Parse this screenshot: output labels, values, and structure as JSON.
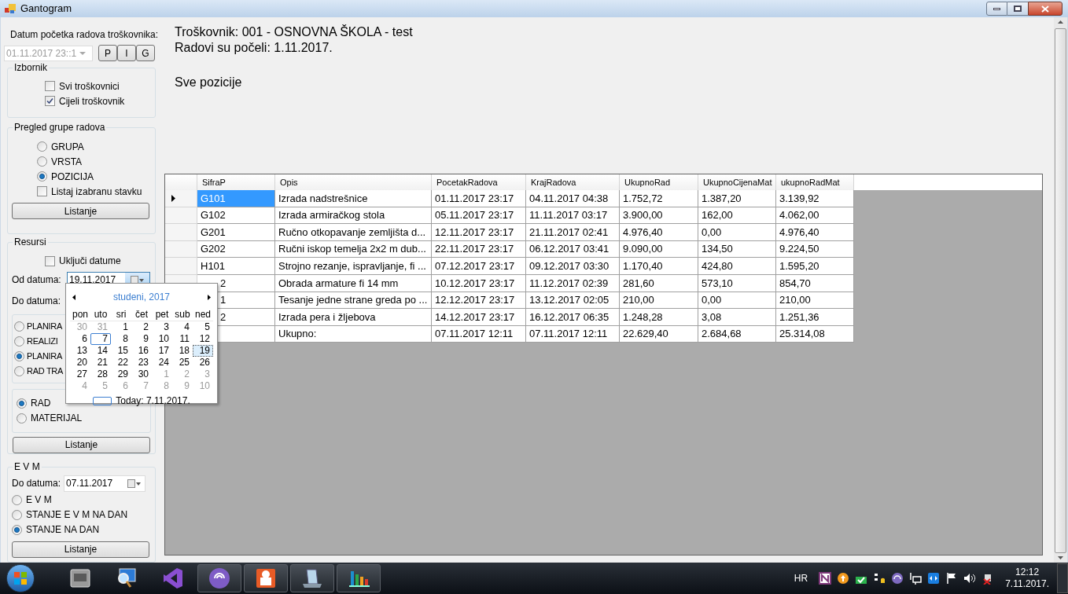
{
  "window": {
    "title": "Gantogram"
  },
  "left": {
    "start_label": "Datum početka radova troškovnika:",
    "start_value": "01.11.2017 23::1",
    "start_buttons": [
      "P",
      "I",
      "G"
    ],
    "izbornik": {
      "title": "Izbornik",
      "checkboxes": [
        {
          "label": "Svi troškovnici",
          "checked": false
        },
        {
          "label": "Cijeli troškovnik",
          "checked": true
        }
      ]
    },
    "pregled": {
      "title": "Pregled grupe radova",
      "radios": [
        {
          "label": "GRUPA",
          "selected": false
        },
        {
          "label": "VRSTA",
          "selected": false
        },
        {
          "label": "POZICIJA",
          "selected": true
        }
      ],
      "checkbox": {
        "label": "Listaj izabranu stavku",
        "checked": false
      },
      "button": "Listanje"
    },
    "resursi": {
      "title": "Resursi",
      "checkbox": {
        "label": "Uključi datume",
        "checked": false
      },
      "od_label": "Od datuma:",
      "od_value": "19.11.2017",
      "do_label": "Do datuma:",
      "radios": [
        {
          "label": "PLANIRA",
          "selected": false
        },
        {
          "label": "REALIZI",
          "selected": false
        },
        {
          "label": "PLANIRA",
          "selected": true
        },
        {
          "label": "RAD TRA",
          "selected": false
        }
      ],
      "radios2": [
        {
          "label": "RAD",
          "selected": true
        },
        {
          "label": "MATERIJAL",
          "selected": false
        }
      ],
      "button": "Listanje"
    },
    "evm": {
      "title": "E V M",
      "do_label": "Do datuma:",
      "do_value": "07.11.2017",
      "radios": [
        {
          "label": "E V M",
          "selected": false
        },
        {
          "label": "STANJE  E V M   NA DAN",
          "selected": false
        },
        {
          "label": "STANJE NA DAN",
          "selected": true
        }
      ],
      "button": "Listanje"
    }
  },
  "calendar": {
    "month": "studeni, 2017",
    "weekdays": [
      "pon",
      "uto",
      "sri",
      "čet",
      "pet",
      "sub",
      "ned"
    ],
    "weeks": [
      [
        {
          "day": "30",
          "other_month": true,
          "today": false,
          "selected": false
        },
        {
          "day": "31",
          "other_month": true,
          "today": false,
          "selected": false
        },
        {
          "day": "1",
          "other_month": false,
          "today": false,
          "selected": false
        },
        {
          "day": "2",
          "other_month": false,
          "today": false,
          "selected": false
        },
        {
          "day": "3",
          "other_month": false,
          "today": false,
          "selected": false
        },
        {
          "day": "4",
          "other_month": false,
          "today": false,
          "selected": false
        },
        {
          "day": "5",
          "other_month": false,
          "today": false,
          "selected": false
        }
      ],
      [
        {
          "day": "6",
          "other_month": false,
          "today": false,
          "selected": false
        },
        {
          "day": "7",
          "other_month": false,
          "today": true,
          "selected": false
        },
        {
          "day": "8",
          "other_month": false,
          "today": false,
          "selected": false
        },
        {
          "day": "9",
          "other_month": false,
          "today": false,
          "selected": false
        },
        {
          "day": "10",
          "other_month": false,
          "today": false,
          "selected": false
        },
        {
          "day": "11",
          "other_month": false,
          "today": false,
          "selected": false
        },
        {
          "day": "12",
          "other_month": false,
          "today": false,
          "selected": false
        }
      ],
      [
        {
          "day": "13",
          "other_month": false,
          "today": false,
          "selected": false
        },
        {
          "day": "14",
          "other_month": false,
          "today": false,
          "selected": false
        },
        {
          "day": "15",
          "other_month": false,
          "today": false,
          "selected": false
        },
        {
          "day": "16",
          "other_month": false,
          "today": false,
          "selected": false
        },
        {
          "day": "17",
          "other_month": false,
          "today": false,
          "selected": false
        },
        {
          "day": "18",
          "other_month": false,
          "today": false,
          "selected": false
        },
        {
          "day": "19",
          "other_month": false,
          "today": false,
          "selected": true
        }
      ],
      [
        {
          "day": "20",
          "other_month": false,
          "today": false,
          "selected": false
        },
        {
          "day": "21",
          "other_month": false,
          "today": false,
          "selected": false
        },
        {
          "day": "22",
          "other_month": false,
          "today": false,
          "selected": false
        },
        {
          "day": "23",
          "other_month": false,
          "today": false,
          "selected": false
        },
        {
          "day": "24",
          "other_month": false,
          "today": false,
          "selected": false
        },
        {
          "day": "25",
          "other_month": false,
          "today": false,
          "selected": false
        },
        {
          "day": "26",
          "other_month": false,
          "today": false,
          "selected": false
        }
      ],
      [
        {
          "day": "27",
          "other_month": false,
          "today": false,
          "selected": false
        },
        {
          "day": "28",
          "other_month": false,
          "today": false,
          "selected": false
        },
        {
          "day": "29",
          "other_month": false,
          "today": false,
          "selected": false
        },
        {
          "day": "30",
          "other_month": false,
          "today": false,
          "selected": false
        },
        {
          "day": "1",
          "other_month": true,
          "today": false,
          "selected": false
        },
        {
          "day": "2",
          "other_month": true,
          "today": false,
          "selected": false
        },
        {
          "day": "3",
          "other_month": true,
          "today": false,
          "selected": false
        }
      ],
      [
        {
          "day": "4",
          "other_month": true,
          "today": false,
          "selected": false
        },
        {
          "day": "5",
          "other_month": true,
          "today": false,
          "selected": false
        },
        {
          "day": "6",
          "other_month": true,
          "today": false,
          "selected": false
        },
        {
          "day": "7",
          "other_month": true,
          "today": false,
          "selected": false
        },
        {
          "day": "8",
          "other_month": true,
          "today": false,
          "selected": false
        },
        {
          "day": "9",
          "other_month": true,
          "today": false,
          "selected": false
        },
        {
          "day": "10",
          "other_month": true,
          "today": false,
          "selected": false
        }
      ]
    ],
    "today_label": "Today: 7.11.2017."
  },
  "header": {
    "lines": [
      "Troškovnik: 001 - OSNOVNA ŠKOLA - test",
      "Radovi su počeli: 1.11.2017."
    ],
    "subtitle": "Sve pozicije"
  },
  "grid": {
    "columns": [
      "SifraP",
      "Opis",
      "PocetakRadova",
      "KrajRadova",
      "UkupnoRad",
      "UkupnoCijenaMat",
      "ukupnoRadMat"
    ],
    "rows": [
      {
        "current": true,
        "selected": true,
        "covered": false,
        "cells": [
          "G101",
          "Izrada nadstrešnice",
          "01.11.2017 23:17",
          "04.11.2017 04:38",
          "1.752,72",
          "1.387,20",
          "3.139,92"
        ]
      },
      {
        "current": false,
        "selected": false,
        "covered": false,
        "cells": [
          "G102",
          "Izrada armiračkog stola",
          "05.11.2017 23:17",
          "11.11.2017 03:17",
          "3.900,00",
          "162,00",
          "4.062,00"
        ]
      },
      {
        "current": false,
        "selected": false,
        "covered": false,
        "cells": [
          "G201",
          "Ručno otkopavanje zemljišta d...",
          "12.11.2017 23:17",
          "21.11.2017 02:41",
          "4.976,40",
          "0,00",
          "4.976,40"
        ]
      },
      {
        "current": false,
        "selected": false,
        "covered": false,
        "cells": [
          "G202",
          "Ručni iskop temelja 2x2 m dub...",
          "22.11.2017 23:17",
          "06.12.2017 03:41",
          "9.090,00",
          "134,50",
          "9.224,50"
        ]
      },
      {
        "current": false,
        "selected": false,
        "covered": false,
        "cells": [
          "H101",
          "Strojno rezanje, ispravljanje, fi ...",
          "07.12.2017 23:17",
          "09.12.2017 03:30",
          "1.170,40",
          "424,80",
          "1.595,20"
        ]
      },
      {
        "current": false,
        "selected": false,
        "covered": true,
        "cells": [
          "2",
          "Obrada armature fi 14 mm",
          "10.12.2017 23:17",
          "11.12.2017 02:39",
          "281,60",
          "573,10",
          "854,70"
        ]
      },
      {
        "selected": false,
        "covered": true,
        "cells": [
          "1",
          "Tesanje jedne strane greda po ...",
          "12.12.2017 23:17",
          "13.12.2017 02:05",
          "210,00",
          "0,00",
          "210,00"
        ]
      },
      {
        "selected": false,
        "covered": true,
        "cells": [
          "2",
          "Izrada pera i žljebova",
          "14.12.2017 23:17",
          "16.12.2017 06:35",
          "1.248,28",
          "3,08",
          "1.251,36"
        ]
      },
      {
        "selected": false,
        "cells": [
          "",
          "Ukupno:",
          "07.11.2017 12:11",
          "07.11.2017 12:11",
          "22.629,40",
          "2.684,68",
          "25.314,08"
        ]
      }
    ]
  },
  "taskbar": {
    "apps": [
      {
        "kind": "window",
        "running": false
      },
      {
        "kind": "monitor",
        "running": false
      },
      {
        "kind": "studio",
        "running": false
      },
      {
        "kind": "torrent",
        "running": true
      },
      {
        "kind": "slides",
        "running": true
      },
      {
        "kind": "server",
        "running": true
      },
      {
        "kind": "chart",
        "running": true
      }
    ],
    "language": "HR",
    "time": "12:12",
    "date": "7.11.2017."
  }
}
